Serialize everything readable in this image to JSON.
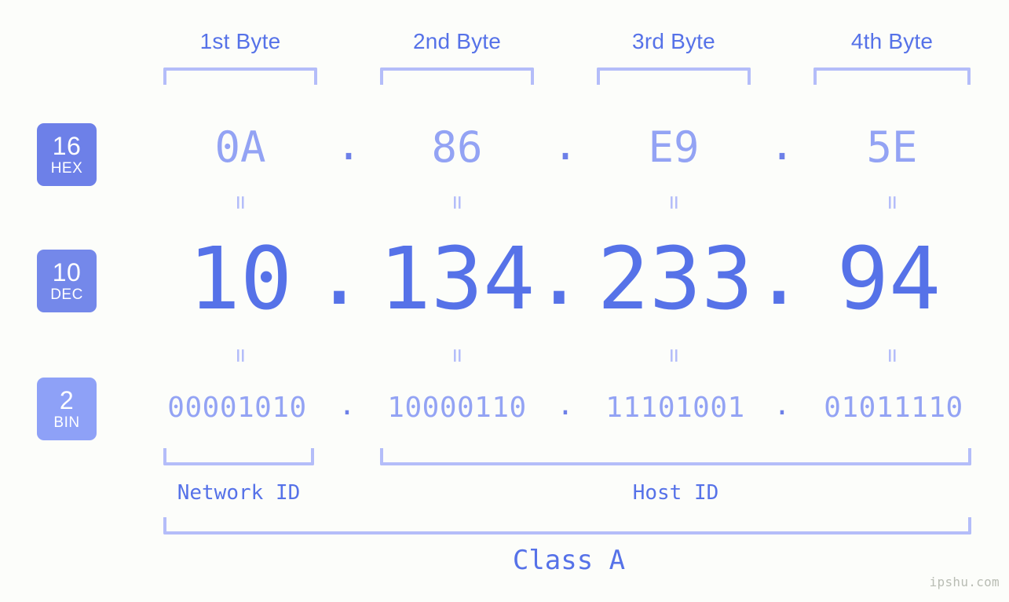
{
  "meta": {
    "background_color": "#fcfdfa",
    "accent_color": "#5672e8",
    "accent_light": "#93a3f4",
    "bracket_color": "#b4bdf9",
    "badge_hex_color": "#6d80e8",
    "badge_dec_color": "#7488ea",
    "badge_bin_color": "#8ea1f7"
  },
  "byte_headers": [
    {
      "label": "1st Byte"
    },
    {
      "label": "2nd Byte"
    },
    {
      "label": "3rd Byte"
    },
    {
      "label": "4th Byte"
    }
  ],
  "row_badges": [
    {
      "base": "16",
      "name": "HEX"
    },
    {
      "base": "10",
      "name": "DEC"
    },
    {
      "base": "2",
      "name": "BIN"
    }
  ],
  "separators": {
    "dot": "."
  },
  "equals_symbol": "=",
  "rows": {
    "hex": {
      "base_label": "16",
      "base_name": "HEX",
      "octets": [
        "0A",
        "86",
        "E9",
        "5E"
      ]
    },
    "dec": {
      "base_label": "10",
      "base_name": "DEC",
      "octets": [
        "10",
        "134",
        "233",
        "94"
      ]
    },
    "bin": {
      "base_label": "2",
      "base_name": "BIN",
      "octets": [
        "00001010",
        "10000110",
        "11101001",
        "01011110"
      ]
    }
  },
  "segments": {
    "network_id_label": "Network ID",
    "host_id_label": "Host ID",
    "class_label": "Class A"
  },
  "watermark": "ipshu.com"
}
